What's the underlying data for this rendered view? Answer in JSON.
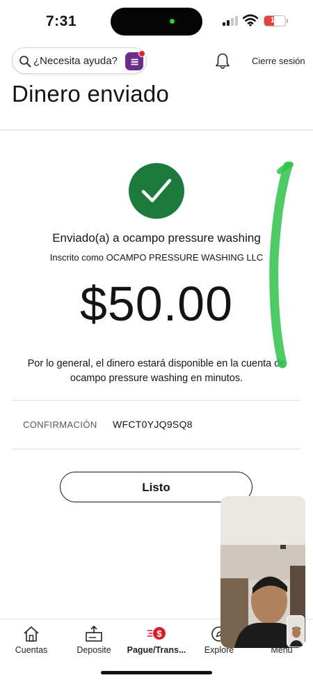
{
  "status_bar": {
    "time": "7:31",
    "battery_level": "17",
    "battery_color": "#e0443e"
  },
  "header": {
    "search_placeholder": "¿Necesita ayuda?",
    "assistant_icon": "fargo-assistant-icon",
    "notifications_icon": "bell-icon",
    "signout_label": "Cierre sesión"
  },
  "page": {
    "title": "Dinero enviado"
  },
  "confirmation": {
    "status_icon": "checkmark-icon",
    "success_color": "#1b7a3c",
    "sent_to": "Enviado(a) a ocampo pressure washing",
    "enrolled_as": "Inscrito como OCAMPO PRESSURE WASHING LLC",
    "amount": "$50.00",
    "availability_text": "Por lo general, el dinero estará disponible en la cuenta de ocampo pressure washing en minutos.",
    "confirmation_label": "CONFIRMACIÓN",
    "confirmation_code": "WFCT0YJQ9SQ8",
    "done_label": "Listo"
  },
  "bottom_nav": {
    "items": [
      {
        "label": "Cuentas",
        "icon": "home-icon"
      },
      {
        "label": "Deposite",
        "icon": "deposit-icon"
      },
      {
        "label": "Pague/Trans...",
        "icon": "pay-transfer-icon",
        "active": true
      },
      {
        "label": "Explore",
        "icon": "compass-icon"
      },
      {
        "label": "Menu",
        "icon": "menu-icon"
      }
    ]
  },
  "overlays": {
    "video_call": "facetime-pip",
    "annotation_color": "#2fc24a"
  }
}
